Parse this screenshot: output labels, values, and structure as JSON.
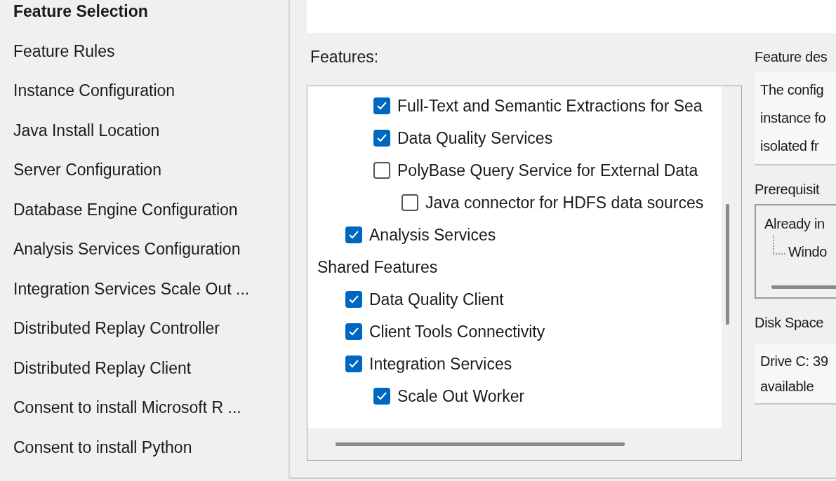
{
  "sidebar": {
    "items": [
      {
        "label": "Feature Selection",
        "selected": true
      },
      {
        "label": "Feature Rules",
        "selected": false
      },
      {
        "label": "Instance Configuration",
        "selected": false
      },
      {
        "label": "Java Install Location",
        "selected": false
      },
      {
        "label": "Server Configuration",
        "selected": false
      },
      {
        "label": "Database Engine Configuration",
        "selected": false
      },
      {
        "label": "Analysis Services Configuration",
        "selected": false
      },
      {
        "label": "Integration Services Scale Out ...",
        "selected": false
      },
      {
        "label": "Distributed Replay Controller",
        "selected": false
      },
      {
        "label": "Distributed Replay Client",
        "selected": false
      },
      {
        "label": "Consent to install Microsoft R ...",
        "selected": false
      },
      {
        "label": "Consent to install Python",
        "selected": false
      }
    ]
  },
  "features": {
    "label": "Features:",
    "tree": [
      {
        "children": [
          {
            "children": [
              {
                "label": "Full-Text and Semantic Extractions for Sea",
                "checked": true
              },
              {
                "label": "Data Quality Services",
                "checked": true
              },
              {
                "label": "PolyBase Query Service for External Data",
                "checked": false,
                "children": [
                  {
                    "label": "Java connector for HDFS data sources",
                    "checked": false
                  }
                ]
              }
            ]
          },
          {
            "label": "Analysis Services",
            "checked": true
          }
        ]
      },
      {
        "label": "Shared Features",
        "children": [
          {
            "label": "Data Quality Client",
            "checked": true
          },
          {
            "label": "Client Tools Connectivity",
            "checked": true
          },
          {
            "label": "Integration Services",
            "checked": true,
            "children": [
              {
                "label": "Scale Out Worker",
                "checked": true
              }
            ]
          }
        ]
      }
    ]
  },
  "description": {
    "label": "Feature des",
    "lines": [
      "The config",
      "instance fo",
      "isolated fr"
    ]
  },
  "prerequisites": {
    "label": "Prerequisit",
    "heading": "Already in",
    "items": [
      "Windo"
    ]
  },
  "disk_space": {
    "label": "Disk Space",
    "lines": [
      "Drive C: 39",
      "available"
    ]
  }
}
